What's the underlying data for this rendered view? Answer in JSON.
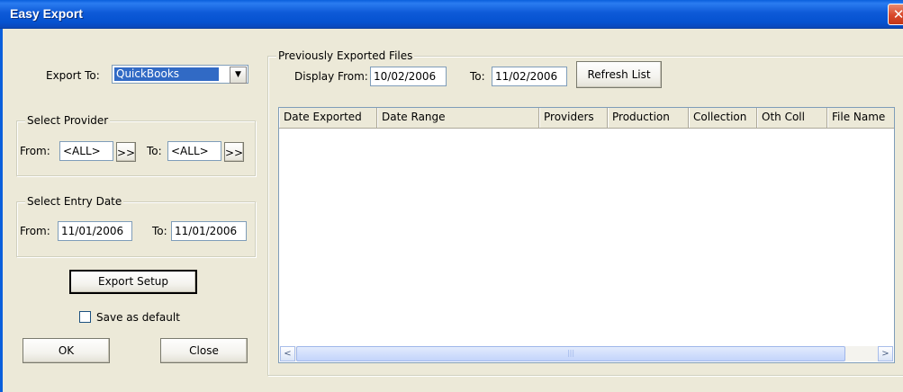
{
  "window": {
    "title": "Easy Export",
    "close_glyph": "✕"
  },
  "export_to": {
    "label": "Export To:",
    "selected": "QuickBooks",
    "arrow": "▼"
  },
  "select_provider": {
    "legend": "Select Provider",
    "from_label": "From:",
    "from_value": "<ALL>",
    "to_label": "To:",
    "to_value": "<ALL>",
    "browse_label": ">>"
  },
  "select_entry_date": {
    "legend": "Select Entry Date",
    "from_label": "From:",
    "from_value": "11/01/2006",
    "to_label": "To:",
    "to_value": "11/01/2006"
  },
  "buttons": {
    "export_setup": "Export Setup",
    "ok": "OK",
    "close": "Close",
    "refresh_list": "Refresh List"
  },
  "save_default": {
    "label": "Save as default",
    "checked": false
  },
  "previous_files": {
    "legend": "Previously Exported Files",
    "display_from_label": "Display From:",
    "display_from_value": "10/02/2006",
    "to_label": "To:",
    "to_value": "11/02/2006",
    "columns": [
      "Date Exported",
      "Date Range",
      "Providers",
      "Production",
      "Collection",
      "Oth Coll",
      "File Name"
    ],
    "rows": []
  },
  "scrollbar": {
    "left_arrow": "<",
    "right_arrow": ">",
    "thumb_grip": "|||"
  }
}
